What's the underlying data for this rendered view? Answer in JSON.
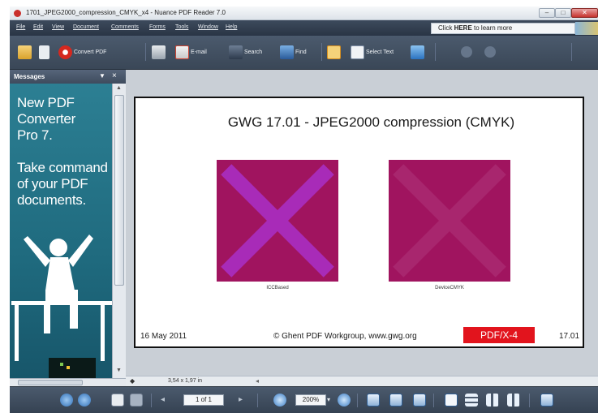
{
  "window": {
    "title": "1701_JPEG2000_compression_CMYK_x4 - Nuance PDF Reader 7.0"
  },
  "menu": [
    "File",
    "Edit",
    "View",
    "Document",
    "Comments",
    "Forms",
    "Tools",
    "Window",
    "Help"
  ],
  "promo": {
    "pre": "Click ",
    "bold": "HERE",
    "post": " to learn more"
  },
  "toolbar": {
    "convert_label": "Convert PDF",
    "email_label": "E-mail",
    "search_label": "Search",
    "find_label": "Find",
    "select_text_label": "Select Text"
  },
  "panel": {
    "title": "Messages",
    "ad_lines": [
      "New PDF",
      "Converter",
      "Pro 7.",
      "Take command",
      "of your PDF",
      "documents."
    ]
  },
  "document": {
    "title": "GWG 17.01 - JPEG2000 compression (CMYK)",
    "caption_left": "ICCBased",
    "caption_right": "DeviceCMYK",
    "footer_date": "16 May 2011",
    "footer_credit": "© Ghent PDF Workgroup, www.gwg.org",
    "footer_badge": "PDF/X-4",
    "footer_number": "17.01",
    "colors": {
      "square": "#a0145f",
      "x_left": "#a82bb8",
      "x_right": "#a8266e",
      "badge": "#e2141d"
    }
  },
  "status": {
    "dimensions": "3,54 x 1,97 in"
  },
  "nav": {
    "page_indicator": "1 of 1",
    "zoom": "200%"
  }
}
